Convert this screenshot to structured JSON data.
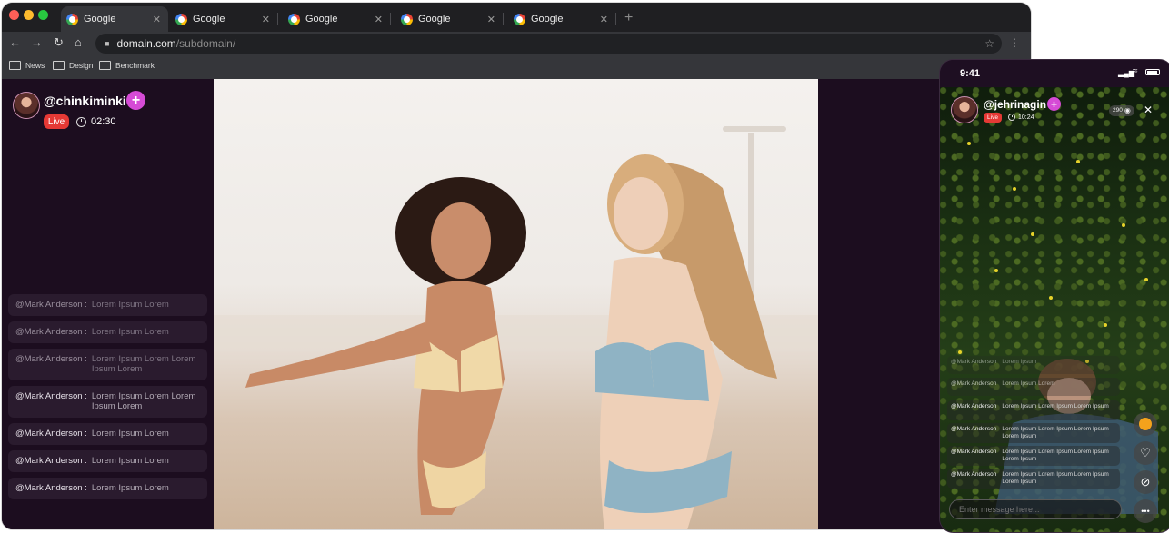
{
  "browser": {
    "tabs": [
      {
        "label": "Google",
        "close": "✕"
      },
      {
        "label": "Google",
        "close": "✕"
      },
      {
        "label": "Google",
        "close": "✕"
      },
      {
        "label": "Google",
        "close": "✕"
      },
      {
        "label": "Google",
        "close": "✕"
      }
    ],
    "new_tab": "+",
    "url_domain": "domain.com",
    "url_path": "/subdomain/",
    "bookmarks": [
      "News",
      "Design",
      "Benchmark"
    ]
  },
  "stream": {
    "username": "@chinkiminki",
    "follow": "+",
    "live_label": "Live",
    "duration": "02:30",
    "comments": [
      {
        "user": "@Mark Anderson :",
        "text": "Lorem Ipsum Lorem"
      },
      {
        "user": "@Mark Anderson :",
        "text": "Lorem Ipsum Lorem"
      },
      {
        "user": "@Mark Anderson :",
        "text": "Lorem Ipsum Lorem Lorem Ipsum Lorem"
      },
      {
        "user": "@Mark Anderson :",
        "text": "Lorem Ipsum Lorem Lorem Ipsum Lorem"
      },
      {
        "user": "@Mark Anderson :",
        "text": "Lorem Ipsum Lorem"
      },
      {
        "user": "@Mark Anderson :",
        "text": "Lorem Ipsum Lorem"
      },
      {
        "user": "@Mark Anderson :",
        "text": "Lorem Ipsum Lorem"
      }
    ]
  },
  "phone": {
    "time": "9:41",
    "username": "@jehrinagin",
    "follow": "+",
    "live_label": "Live",
    "duration": "10:24",
    "viewers": "290",
    "close": "✕",
    "comments": [
      {
        "user": "@Mark Anderson",
        "text": "Lorem Ipsum"
      },
      {
        "user": "@Mark Anderson",
        "text": "Lorem Ipsum Lorem"
      },
      {
        "user": "@Mark Anderson",
        "text": "Lorem Ipsum Lorem Ipsum Lorem Ipsum"
      },
      {
        "user": "@Mark Anderson",
        "text": "Lorem Ipsum Lorem Ipsum Lorem Ipsum Lorem Ipsum"
      },
      {
        "user": "@Mark Anderson",
        "text": "Lorem Ipsum Lorem Ipsum Lorem Ipsum Lorem Ipsum"
      },
      {
        "user": "@Mark Anderson",
        "text": "Lorem Ipsum Lorem Ipsum Lorem Ipsum Lorem Ipsum"
      }
    ],
    "input_placeholder": "Enter message here...",
    "more": "•••"
  }
}
